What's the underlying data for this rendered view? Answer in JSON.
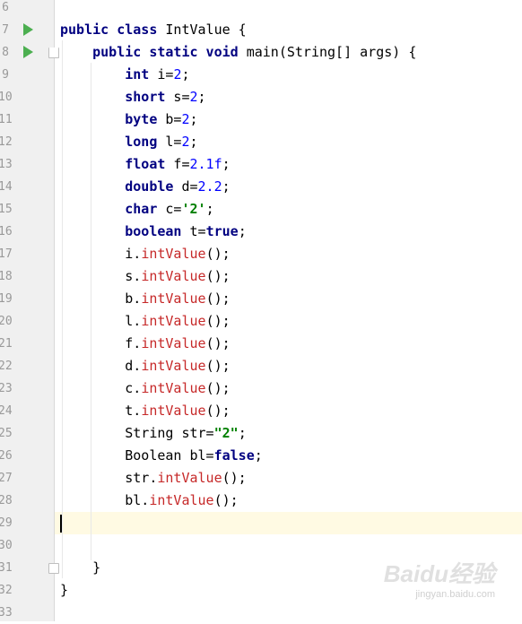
{
  "editor": {
    "file_lines": [
      {
        "n": "6",
        "tokens": []
      },
      {
        "n": "7",
        "tokens": [
          {
            "t": "public class",
            "c": "kw"
          },
          {
            "t": " IntValue {",
            "c": ""
          }
        ]
      },
      {
        "n": "8",
        "tokens": [
          {
            "t": "    public static void",
            "c": "kw"
          },
          {
            "t": " main(String[] args) {",
            "c": ""
          }
        ]
      },
      {
        "n": "9",
        "tokens": [
          {
            "t": "        int",
            "c": "kw"
          },
          {
            "t": " i=",
            "c": ""
          },
          {
            "t": "2",
            "c": "num"
          },
          {
            "t": ";",
            "c": ""
          }
        ]
      },
      {
        "n": "10",
        "tokens": [
          {
            "t": "        short",
            "c": "kw"
          },
          {
            "t": " s=",
            "c": ""
          },
          {
            "t": "2",
            "c": "num"
          },
          {
            "t": ";",
            "c": ""
          }
        ]
      },
      {
        "n": "11",
        "tokens": [
          {
            "t": "        byte",
            "c": "kw"
          },
          {
            "t": " b=",
            "c": ""
          },
          {
            "t": "2",
            "c": "num"
          },
          {
            "t": ";",
            "c": ""
          }
        ]
      },
      {
        "n": "12",
        "tokens": [
          {
            "t": "        long",
            "c": "kw"
          },
          {
            "t": " l=",
            "c": ""
          },
          {
            "t": "2",
            "c": "num"
          },
          {
            "t": ";",
            "c": ""
          }
        ]
      },
      {
        "n": "13",
        "tokens": [
          {
            "t": "        float",
            "c": "kw"
          },
          {
            "t": " f=",
            "c": ""
          },
          {
            "t": "2.1f",
            "c": "num"
          },
          {
            "t": ";",
            "c": ""
          }
        ]
      },
      {
        "n": "14",
        "tokens": [
          {
            "t": "        double",
            "c": "kw"
          },
          {
            "t": " d=",
            "c": ""
          },
          {
            "t": "2.2",
            "c": "num"
          },
          {
            "t": ";",
            "c": ""
          }
        ]
      },
      {
        "n": "15",
        "tokens": [
          {
            "t": "        char",
            "c": "kw"
          },
          {
            "t": " c=",
            "c": ""
          },
          {
            "t": "'2'",
            "c": "str"
          },
          {
            "t": ";",
            "c": ""
          }
        ]
      },
      {
        "n": "16",
        "tokens": [
          {
            "t": "        boolean",
            "c": "kw"
          },
          {
            "t": " t=",
            "c": ""
          },
          {
            "t": "true",
            "c": "kw"
          },
          {
            "t": ";",
            "c": ""
          }
        ]
      },
      {
        "n": "17",
        "tokens": [
          {
            "t": "        i.",
            "c": ""
          },
          {
            "t": "intValue",
            "c": "mcall"
          },
          {
            "t": "();",
            "c": ""
          }
        ]
      },
      {
        "n": "18",
        "tokens": [
          {
            "t": "        s.",
            "c": ""
          },
          {
            "t": "intValue",
            "c": "mcall"
          },
          {
            "t": "();",
            "c": ""
          }
        ]
      },
      {
        "n": "19",
        "tokens": [
          {
            "t": "        b.",
            "c": ""
          },
          {
            "t": "intValue",
            "c": "mcall"
          },
          {
            "t": "();",
            "c": ""
          }
        ]
      },
      {
        "n": "20",
        "tokens": [
          {
            "t": "        l.",
            "c": ""
          },
          {
            "t": "intValue",
            "c": "mcall"
          },
          {
            "t": "();",
            "c": ""
          }
        ]
      },
      {
        "n": "21",
        "tokens": [
          {
            "t": "        f.",
            "c": ""
          },
          {
            "t": "intValue",
            "c": "mcall"
          },
          {
            "t": "();",
            "c": ""
          }
        ]
      },
      {
        "n": "22",
        "tokens": [
          {
            "t": "        d.",
            "c": ""
          },
          {
            "t": "intValue",
            "c": "mcall"
          },
          {
            "t": "();",
            "c": ""
          }
        ]
      },
      {
        "n": "23",
        "tokens": [
          {
            "t": "        c.",
            "c": ""
          },
          {
            "t": "intValue",
            "c": "mcall"
          },
          {
            "t": "();",
            "c": ""
          }
        ]
      },
      {
        "n": "24",
        "tokens": [
          {
            "t": "        t.",
            "c": ""
          },
          {
            "t": "intValue",
            "c": "mcall"
          },
          {
            "t": "();",
            "c": ""
          }
        ]
      },
      {
        "n": "25",
        "tokens": [
          {
            "t": "        String str=",
            "c": ""
          },
          {
            "t": "\"2\"",
            "c": "str"
          },
          {
            "t": ";",
            "c": ""
          }
        ]
      },
      {
        "n": "26",
        "tokens": [
          {
            "t": "        Boolean bl=",
            "c": ""
          },
          {
            "t": "false",
            "c": "kw"
          },
          {
            "t": ";",
            "c": ""
          }
        ]
      },
      {
        "n": "27",
        "tokens": [
          {
            "t": "        str.",
            "c": ""
          },
          {
            "t": "intValue",
            "c": "mcall"
          },
          {
            "t": "();",
            "c": ""
          }
        ]
      },
      {
        "n": "28",
        "tokens": [
          {
            "t": "        bl.",
            "c": ""
          },
          {
            "t": "intValue",
            "c": "mcall"
          },
          {
            "t": "();",
            "c": ""
          }
        ]
      },
      {
        "n": "29",
        "tokens": []
      },
      {
        "n": "30",
        "tokens": []
      },
      {
        "n": "31",
        "tokens": [
          {
            "t": "    }",
            "c": ""
          }
        ]
      },
      {
        "n": "32",
        "tokens": [
          {
            "t": "}",
            "c": ""
          }
        ]
      },
      {
        "n": "33",
        "tokens": []
      }
    ],
    "current_line": "29",
    "run_icon_lines": [
      "7",
      "8"
    ],
    "fold_start_lines": [
      "8"
    ],
    "fold_end_lines": [
      "31"
    ],
    "colors": {
      "keyword": "#000080",
      "number": "#0000ff",
      "string": "#008000",
      "method": "#c62828",
      "current_line": "#fffae3",
      "run_icon": "#4caf50"
    }
  },
  "watermark": {
    "main": "Baidu经验",
    "sub": "jingyan.baidu.com"
  }
}
